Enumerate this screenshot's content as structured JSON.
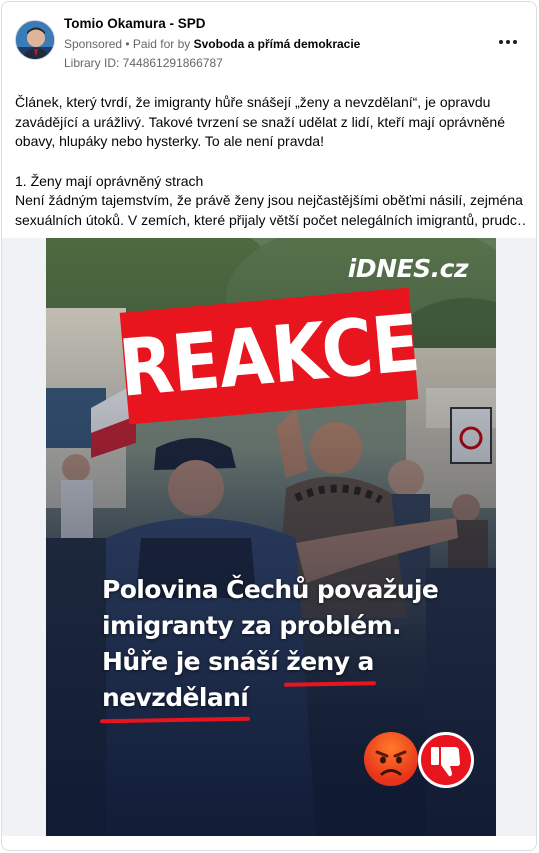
{
  "post": {
    "page_name": "Tomio Okamura - SPD",
    "sponsored": "Sponsored",
    "paid_for_prefix": " • Paid for by ",
    "paid_for_by": "Svoboda a přímá demokracie",
    "library_id": "Library ID: 744861291866787",
    "more_icon": "more-horizontal-icon"
  },
  "text": {
    "paragraph1": "Článek, který tvrdí, že imigranty hůře snášejí „ženy a nevzdělaní“, je opravdu zavádějící a urážlivý. Takové tvrzení se snaží udělat z lidí, kteří mají oprávněné obavy, hlupáky nebo hysterky. To ale není pravda!",
    "heading1": "1. Ženy mají oprávněný strach",
    "line1": "Není žádným tajemstvím, že právě ženy jsou nejčastějšími oběťmi násilí, zejména",
    "line2": "sexuálních útoků. V zemích, které přijaly větší počet nelegálních imigrantů, prudc…"
  },
  "image": {
    "watermark": "iDNES.cz",
    "stamp": "REAKCE",
    "headline_line1": "Polovina Čechů považuje",
    "headline_line2": "imigranty za problém.",
    "headline_line3a": "Hůře je snáší ",
    "headline_line3b": "ženy a",
    "headline_line4": "nevzdělaní",
    "emoji_1": "angry-face-icon",
    "emoji_2": "thumbs-down-icon"
  },
  "colors": {
    "accent_red": "#e8141e",
    "muted_text": "#65676b",
    "image_bg": "#1b2433"
  }
}
